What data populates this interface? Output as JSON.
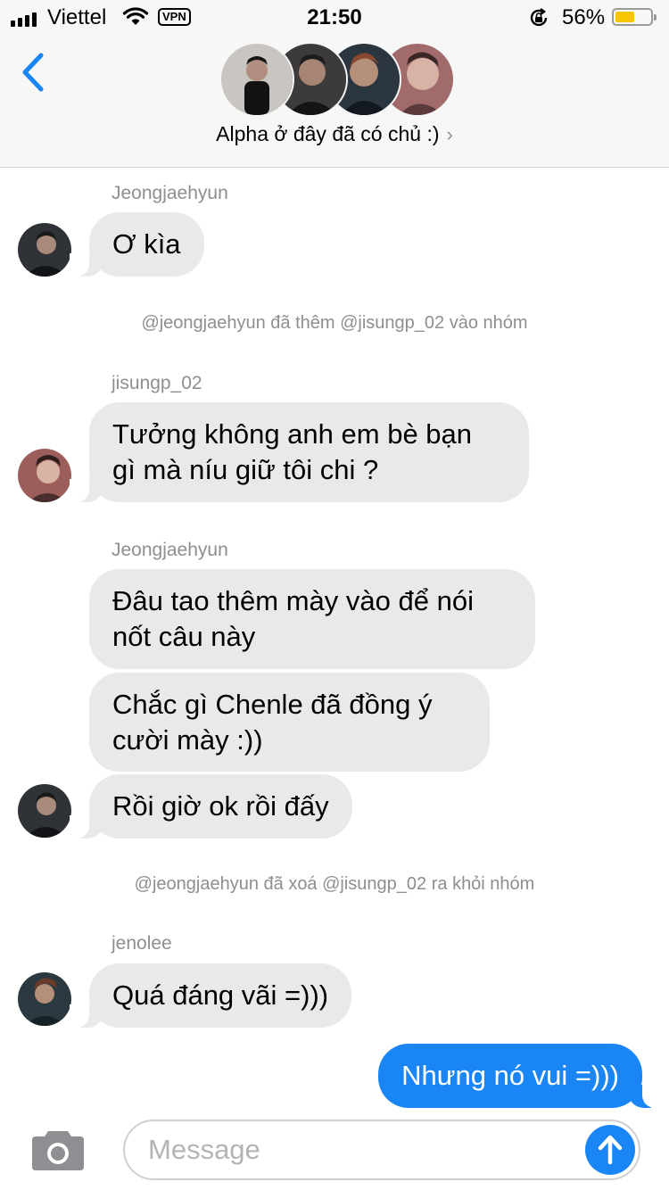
{
  "status_bar": {
    "carrier": "Viettel",
    "vpn": "VPN",
    "time": "21:50",
    "battery": "56%",
    "battery_level": 0.56,
    "battery_color": "#f7c600"
  },
  "header": {
    "group_name": "Alpha ở đây đã có chủ :)",
    "chevron": "›",
    "accent_color": "#1a86f5"
  },
  "messages": {
    "sender_1": "Jeongjaehyun",
    "m1": "Ơ kìa",
    "system_1": "@jeongjaehyun đã thêm @jisungp_02 vào nhóm",
    "sender_2": "jisungp_02",
    "m2_line1": "Tưởng không anh em bè bạn",
    "m2_line2": "gì mà níu giữ tôi chi ?",
    "sender_3": "Jeongjaehyun",
    "m3_line1": "Đâu tao thêm mày vào để nói",
    "m3_line2": "nốt câu này",
    "m4_line1": "Chắc gì Chenle đã đồng ý",
    "m4_line2": "cười mày :))",
    "m5": "Rồi giờ ok rồi đấy",
    "system_2": "@jeongjaehyun đã xoá @jisungp_02 ra khỏi nhóm",
    "sender_4": "jenolee",
    "m6": "Quá đáng vãi =)))",
    "m7_outgoing": "Nhưng nó vui =)))"
  },
  "composer": {
    "placeholder": "Message"
  },
  "icons": {
    "back": "chevron-left-icon",
    "camera": "camera-icon",
    "send": "arrow-up-icon"
  }
}
